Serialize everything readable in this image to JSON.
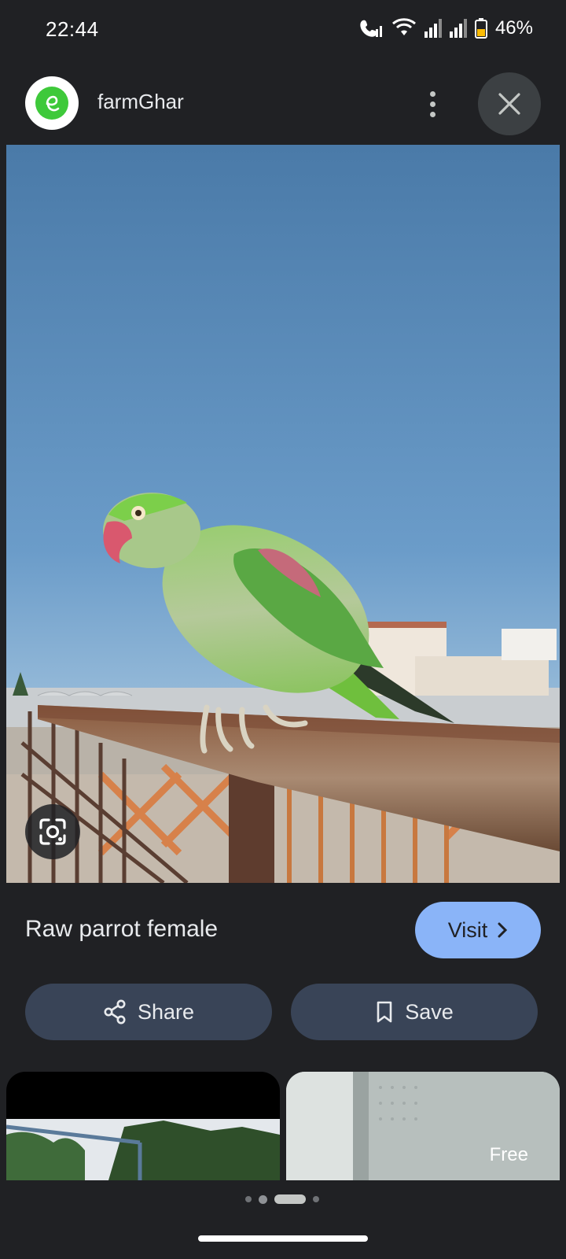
{
  "status_bar": {
    "time": "22:44",
    "battery": "46%",
    "icons": [
      "wifi-calling-icon",
      "wifi-icon",
      "signal-icon",
      "signal-icon",
      "battery-icon"
    ]
  },
  "header": {
    "site_name": "farmGhar",
    "logo_icon": "farmghar-logo-icon",
    "logo_color": "#3ec93a"
  },
  "image": {
    "title": "Raw parrot female",
    "visit_label": "Visit"
  },
  "actions": {
    "share_label": "Share",
    "save_label": "Save"
  },
  "related": {
    "items": [
      {
        "badge": ""
      },
      {
        "badge": "Free"
      }
    ]
  },
  "pager": {
    "count": 4,
    "active_index": 2
  },
  "colors": {
    "background": "#202124",
    "accent": "#8ab4f8",
    "pill": "#394457"
  }
}
